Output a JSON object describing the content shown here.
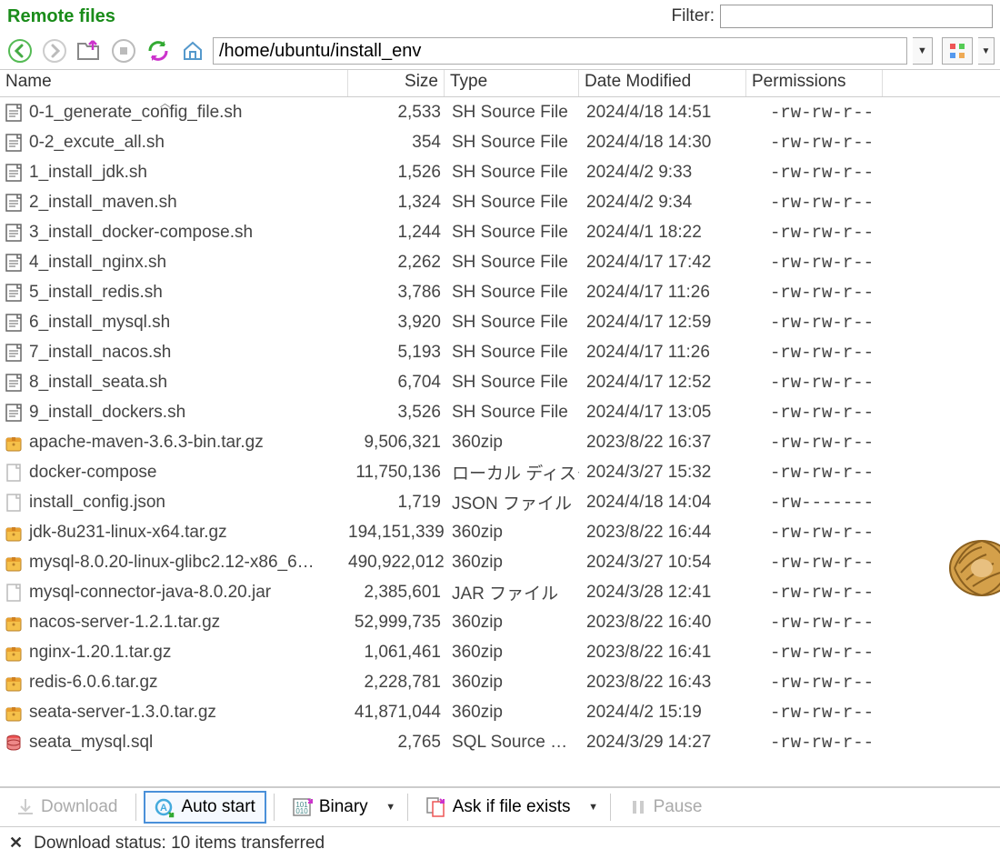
{
  "header": {
    "title": "Remote files",
    "filter_label": "Filter:",
    "filter_value": ""
  },
  "toolbar": {
    "path": "/home/ubuntu/install_env"
  },
  "columns": {
    "name": "Name",
    "size": "Size",
    "type": "Type",
    "date": "Date Modified",
    "perm": "Permissions"
  },
  "files": [
    {
      "icon": "sh",
      "name": "0-1_generate_config_file.sh",
      "size": "2,533",
      "type": "SH Source File",
      "date": "2024/4/18 14:51",
      "perm": "-rw-rw-r--"
    },
    {
      "icon": "sh",
      "name": "0-2_excute_all.sh",
      "size": "354",
      "type": "SH Source File",
      "date": "2024/4/18 14:30",
      "perm": "-rw-rw-r--"
    },
    {
      "icon": "sh",
      "name": "1_install_jdk.sh",
      "size": "1,526",
      "type": "SH Source File",
      "date": "2024/4/2 9:33",
      "perm": "-rw-rw-r--"
    },
    {
      "icon": "sh",
      "name": "2_install_maven.sh",
      "size": "1,324",
      "type": "SH Source File",
      "date": "2024/4/2 9:34",
      "perm": "-rw-rw-r--"
    },
    {
      "icon": "sh",
      "name": "3_install_docker-compose.sh",
      "size": "1,244",
      "type": "SH Source File",
      "date": "2024/4/1 18:22",
      "perm": "-rw-rw-r--"
    },
    {
      "icon": "sh",
      "name": "4_install_nginx.sh",
      "size": "2,262",
      "type": "SH Source File",
      "date": "2024/4/17 17:42",
      "perm": "-rw-rw-r--"
    },
    {
      "icon": "sh",
      "name": "5_install_redis.sh",
      "size": "3,786",
      "type": "SH Source File",
      "date": "2024/4/17 11:26",
      "perm": "-rw-rw-r--"
    },
    {
      "icon": "sh",
      "name": "6_install_mysql.sh",
      "size": "3,920",
      "type": "SH Source File",
      "date": "2024/4/17 12:59",
      "perm": "-rw-rw-r--"
    },
    {
      "icon": "sh",
      "name": "7_install_nacos.sh",
      "size": "5,193",
      "type": "SH Source File",
      "date": "2024/4/17 11:26",
      "perm": "-rw-rw-r--"
    },
    {
      "icon": "sh",
      "name": "8_install_seata.sh",
      "size": "6,704",
      "type": "SH Source File",
      "date": "2024/4/17 12:52",
      "perm": "-rw-rw-r--"
    },
    {
      "icon": "sh",
      "name": "9_install_dockers.sh",
      "size": "3,526",
      "type": "SH Source File",
      "date": "2024/4/17 13:05",
      "perm": "-rw-rw-r--"
    },
    {
      "icon": "zip",
      "name": "apache-maven-3.6.3-bin.tar.gz",
      "size": "9,506,321",
      "type": "360zip",
      "date": "2023/8/22 16:37",
      "perm": "-rw-rw-r--"
    },
    {
      "icon": "file",
      "name": "docker-compose",
      "size": "11,750,136",
      "type": "ローカル ディスク",
      "date": "2024/3/27 15:32",
      "perm": "-rw-rw-r--"
    },
    {
      "icon": "file",
      "name": "install_config.json",
      "size": "1,719",
      "type": "JSON ファイル",
      "date": "2024/4/18 14:04",
      "perm": "-rw-------"
    },
    {
      "icon": "zip",
      "name": "jdk-8u231-linux-x64.tar.gz",
      "size": "194,151,339",
      "type": "360zip",
      "date": "2023/8/22 16:44",
      "perm": "-rw-rw-r--"
    },
    {
      "icon": "zip",
      "name": "mysql-8.0.20-linux-glibc2.12-x86_6…",
      "size": "490,922,012",
      "type": "360zip",
      "date": "2024/3/27 10:54",
      "perm": "-rw-rw-r--"
    },
    {
      "icon": "file",
      "name": "mysql-connector-java-8.0.20.jar",
      "size": "2,385,601",
      "type": "JAR ファイル",
      "date": "2024/3/28 12:41",
      "perm": "-rw-rw-r--"
    },
    {
      "icon": "zip",
      "name": "nacos-server-1.2.1.tar.gz",
      "size": "52,999,735",
      "type": "360zip",
      "date": "2023/8/22 16:40",
      "perm": "-rw-rw-r--"
    },
    {
      "icon": "zip",
      "name": "nginx-1.20.1.tar.gz",
      "size": "1,061,461",
      "type": "360zip",
      "date": "2023/8/22 16:41",
      "perm": "-rw-rw-r--"
    },
    {
      "icon": "zip",
      "name": "redis-6.0.6.tar.gz",
      "size": "2,228,781",
      "type": "360zip",
      "date": "2023/8/22 16:43",
      "perm": "-rw-rw-r--"
    },
    {
      "icon": "zip",
      "name": "seata-server-1.3.0.tar.gz",
      "size": "41,871,044",
      "type": "360zip",
      "date": "2024/4/2 15:19",
      "perm": "-rw-rw-r--"
    },
    {
      "icon": "sql",
      "name": "seata_mysql.sql",
      "size": "2,765",
      "type": "SQL Source …",
      "date": "2024/3/29 14:27",
      "perm": "-rw-rw-r--"
    }
  ],
  "bottom": {
    "download": "Download",
    "auto_start": "Auto start",
    "binary": "Binary",
    "ask_exists": "Ask if file exists",
    "pause": "Pause"
  },
  "status": {
    "text": "Download status: 10 items transferred"
  }
}
